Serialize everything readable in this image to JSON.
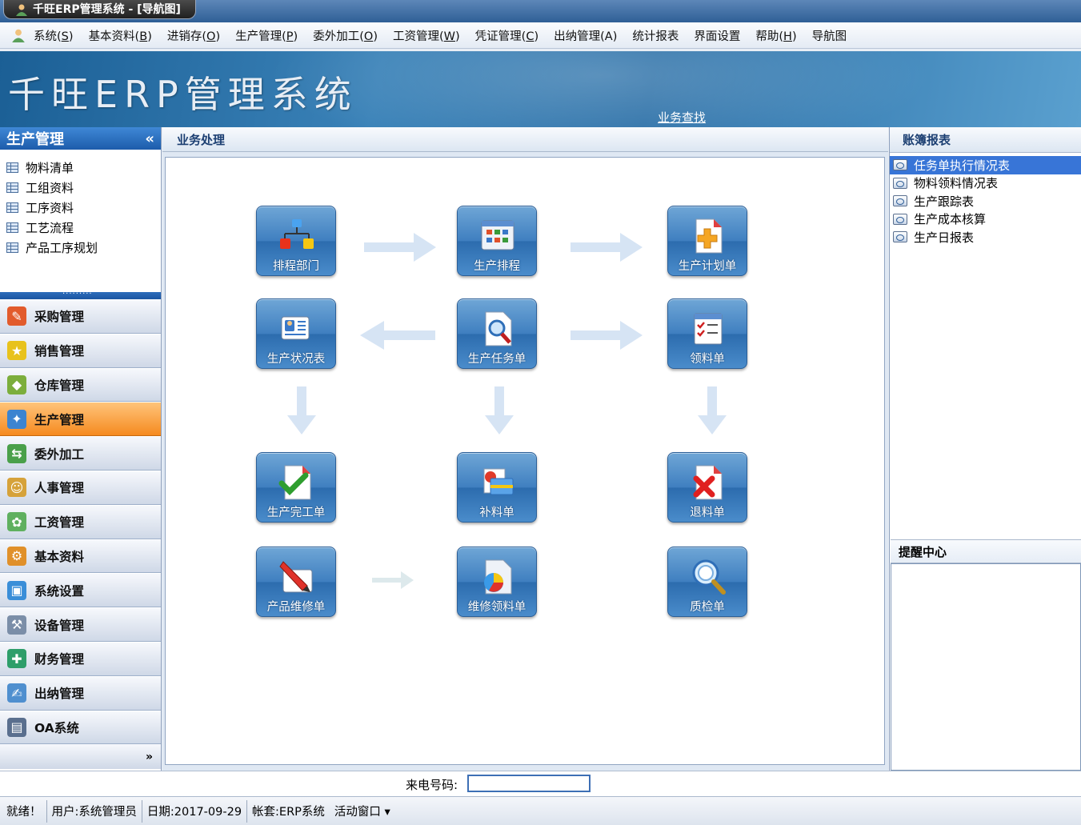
{
  "window": {
    "title": "千旺ERP管理系统 - [导航图]"
  },
  "menu": [
    {
      "text": "系统(",
      "key": "S",
      "tail": ")"
    },
    {
      "text": "基本资料(",
      "key": "B",
      "tail": ")"
    },
    {
      "text": "进销存(",
      "key": "O",
      "tail": ")"
    },
    {
      "text": "生产管理(",
      "key": "P",
      "tail": ")"
    },
    {
      "text": "委外加工(",
      "key": "O",
      "tail": ")"
    },
    {
      "text": "工资管理(",
      "key": "W",
      "tail": ")"
    },
    {
      "text": "凭证管理(",
      "key": "C",
      "tail": ")"
    },
    {
      "text": "出纳管理(A)",
      "key": "",
      "tail": ""
    },
    {
      "text": "统计报表",
      "key": "",
      "tail": ""
    },
    {
      "text": "界面设置",
      "key": "",
      "tail": ""
    },
    {
      "text": "帮助(",
      "key": "H",
      "tail": ")"
    },
    {
      "text": "导航图",
      "key": "",
      "tail": ""
    }
  ],
  "banner": {
    "title": "千旺ERP管理系统",
    "link": "业务查找"
  },
  "left": {
    "title": "生产管理",
    "collapse": "«",
    "tree": [
      "物料清单",
      "工组资料",
      "工序资料",
      "工艺流程",
      "产品工序规划"
    ],
    "modules": [
      {
        "label": "采购管理",
        "icon": "purchase-icon",
        "active": false,
        "color": "#e25b2c"
      },
      {
        "label": "销售管理",
        "icon": "sales-icon",
        "active": false,
        "color": "#e8c21c"
      },
      {
        "label": "仓库管理",
        "icon": "warehouse-icon",
        "active": false,
        "color": "#7cae3c"
      },
      {
        "label": "生产管理",
        "icon": "production-icon",
        "active": true,
        "color": "#3c84d0"
      },
      {
        "label": "委外加工",
        "icon": "outsource-icon",
        "active": false,
        "color": "#4aa04a"
      },
      {
        "label": "人事管理",
        "icon": "hr-icon",
        "active": false,
        "color": "#d6a23a"
      },
      {
        "label": "工资管理",
        "icon": "salary-icon",
        "active": false,
        "color": "#5fb05f"
      },
      {
        "label": "基本资料",
        "icon": "basic-data-icon",
        "active": false,
        "color": "#e0902a"
      },
      {
        "label": "系统设置",
        "icon": "settings-icon",
        "active": false,
        "color": "#3a8ed8"
      },
      {
        "label": "设备管理",
        "icon": "equipment-icon",
        "active": false,
        "color": "#7b8ea8"
      },
      {
        "label": "财务管理",
        "icon": "finance-icon",
        "active": false,
        "color": "#2e9e6a"
      },
      {
        "label": "出纳管理",
        "icon": "cashier-icon",
        "active": false,
        "color": "#4f8fcf"
      },
      {
        "label": "OA系统",
        "icon": "oa-icon",
        "active": false,
        "color": "#5a6f8e"
      }
    ],
    "more": "»"
  },
  "center": {
    "title": "业务处理",
    "buttons": [
      {
        "label": "排程部门",
        "icon": "org-chart-icon"
      },
      {
        "label": "生产排程",
        "icon": "schedule-icon"
      },
      {
        "label": "生产计划单",
        "icon": "plan-add-icon"
      },
      {
        "label": "生产状况表",
        "icon": "status-card-icon"
      },
      {
        "label": "生产任务单",
        "icon": "task-search-icon"
      },
      {
        "label": "领料单",
        "icon": "checklist-icon"
      },
      {
        "label": "生产完工单",
        "icon": "complete-check-icon"
      },
      {
        "label": "补料单",
        "icon": "supplement-icon"
      },
      {
        "label": "退料单",
        "icon": "return-x-icon"
      },
      {
        "label": "产品维修单",
        "icon": "repair-pencil-icon"
      },
      {
        "label": "维修领料单",
        "icon": "repair-pie-icon"
      },
      {
        "label": "质检单",
        "icon": "inspect-magnifier-icon"
      }
    ]
  },
  "right": {
    "title": "账簿报表",
    "reports": [
      "任务单执行情况表",
      "物料领料情况表",
      "生产跟踪表",
      "生产成本核算",
      "生产日报表"
    ],
    "remind_title": "提醒中心"
  },
  "caller": {
    "label": "来电号码:",
    "value": ""
  },
  "status": {
    "ready": "就绪！",
    "user": "用户:系统管理员",
    "date": "日期:2017-09-29",
    "account": "帐套:ERP系统",
    "window": "活动窗口 ▾"
  }
}
